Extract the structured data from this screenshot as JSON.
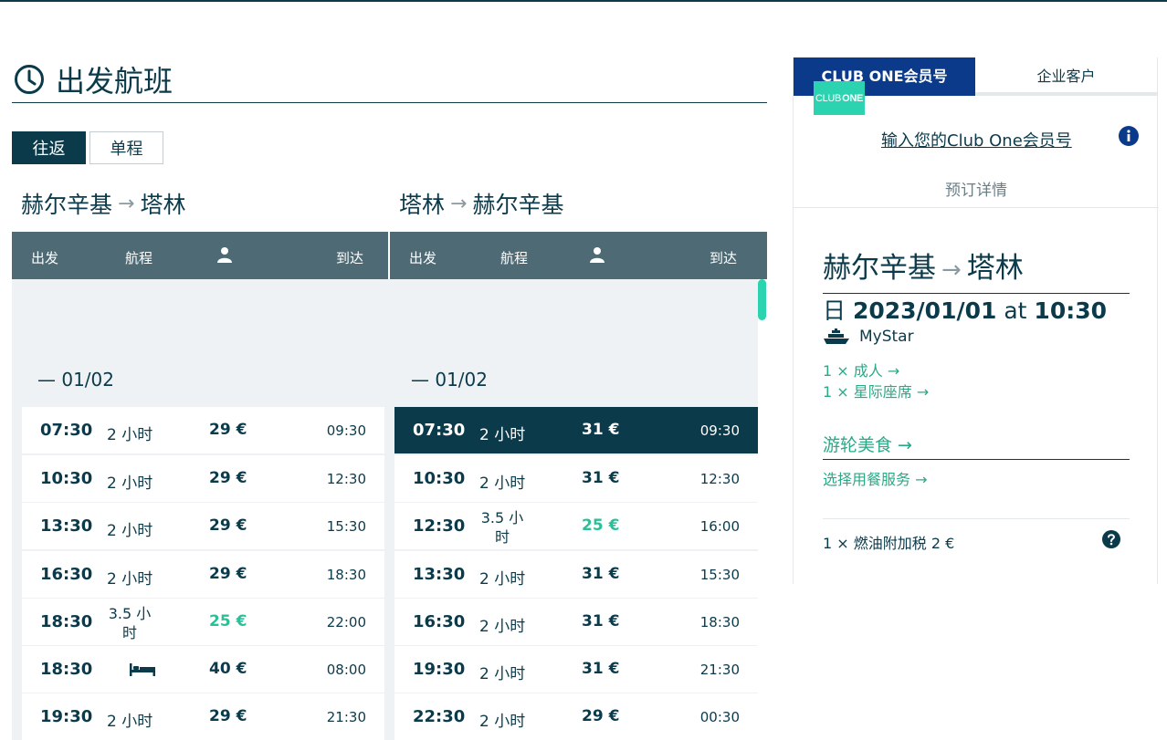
{
  "section": {
    "title": "出发航班"
  },
  "trip_type": {
    "round_trip": "往返",
    "one_way": "单程"
  },
  "outbound": {
    "from": "赫尔辛基",
    "to": "塔林",
    "headers": {
      "depart": "出发",
      "duration": "航程",
      "arrive": "到达"
    },
    "date": "— 01/02",
    "rows": [
      {
        "dep": "07:30",
        "dur": "2 小时",
        "price": "29 €",
        "arr": "09:30"
      },
      {
        "dep": "10:30",
        "dur": "2 小时",
        "price": "29 €",
        "arr": "12:30"
      },
      {
        "dep": "13:30",
        "dur": "2 小时",
        "price": "29 €",
        "arr": "15:30"
      },
      {
        "dep": "16:30",
        "dur": "2 小时",
        "price": "29 €",
        "arr": "18:30"
      },
      {
        "dep": "18:30",
        "dur_line1": "3.5 小",
        "dur_line2": "时",
        "price": "25 €",
        "arr": "22:00"
      },
      {
        "dep": "18:30",
        "dur": "",
        "price": "40 €",
        "arr": "08:00"
      },
      {
        "dep": "19:30",
        "dur": "2 小时",
        "price": "29 €",
        "arr": "21:30"
      }
    ]
  },
  "return": {
    "from": "塔林",
    "to": "赫尔辛基",
    "headers": {
      "depart": "出发",
      "duration": "航程",
      "arrive": "到达"
    },
    "date": "— 01/02",
    "rows": [
      {
        "dep": "07:30",
        "dur": "2 小时",
        "price": "31 €",
        "arr": "09:30"
      },
      {
        "dep": "10:30",
        "dur": "2 小时",
        "price": "31 €",
        "arr": "12:30"
      },
      {
        "dep": "12:30",
        "dur_line1": "3.5 小",
        "dur_line2": "时",
        "price": "25 €",
        "arr": "16:00"
      },
      {
        "dep": "13:30",
        "dur": "2 小时",
        "price": "31 €",
        "arr": "15:30"
      },
      {
        "dep": "16:30",
        "dur": "2 小时",
        "price": "31 €",
        "arr": "18:30"
      },
      {
        "dep": "19:30",
        "dur": "2 小时",
        "price": "31 €",
        "arr": "21:30"
      },
      {
        "dep": "22:30",
        "dur": "2 小时",
        "price": "29 €",
        "arr": "00:30"
      }
    ]
  },
  "sidebar": {
    "tabs": {
      "club_one": "CLUB ONE会员号",
      "corporate": "企业客户"
    },
    "club_logo": {
      "left": "CLUB",
      "right": "ONE"
    },
    "club_link": "输入您的Club One会员号",
    "booking_details": "预订详情",
    "route_from": "赫尔辛基",
    "route_to": "塔林",
    "date_prefix": "日",
    "date": "2023/01/01",
    "at": "at",
    "time": "10:30",
    "ship": "MyStar",
    "adult": "1 × 成人 →",
    "seat": "1 × 星际座席 →",
    "food_title": "游轮美食 →",
    "food_link": "选择用餐服务 →",
    "fuel": "1 × 燃油附加税 2 €"
  },
  "colors": {
    "dark": "#0b3a4a",
    "accent": "#2bd3b0",
    "tab_active": "#0b3a8a",
    "header": "#4e6a75"
  }
}
